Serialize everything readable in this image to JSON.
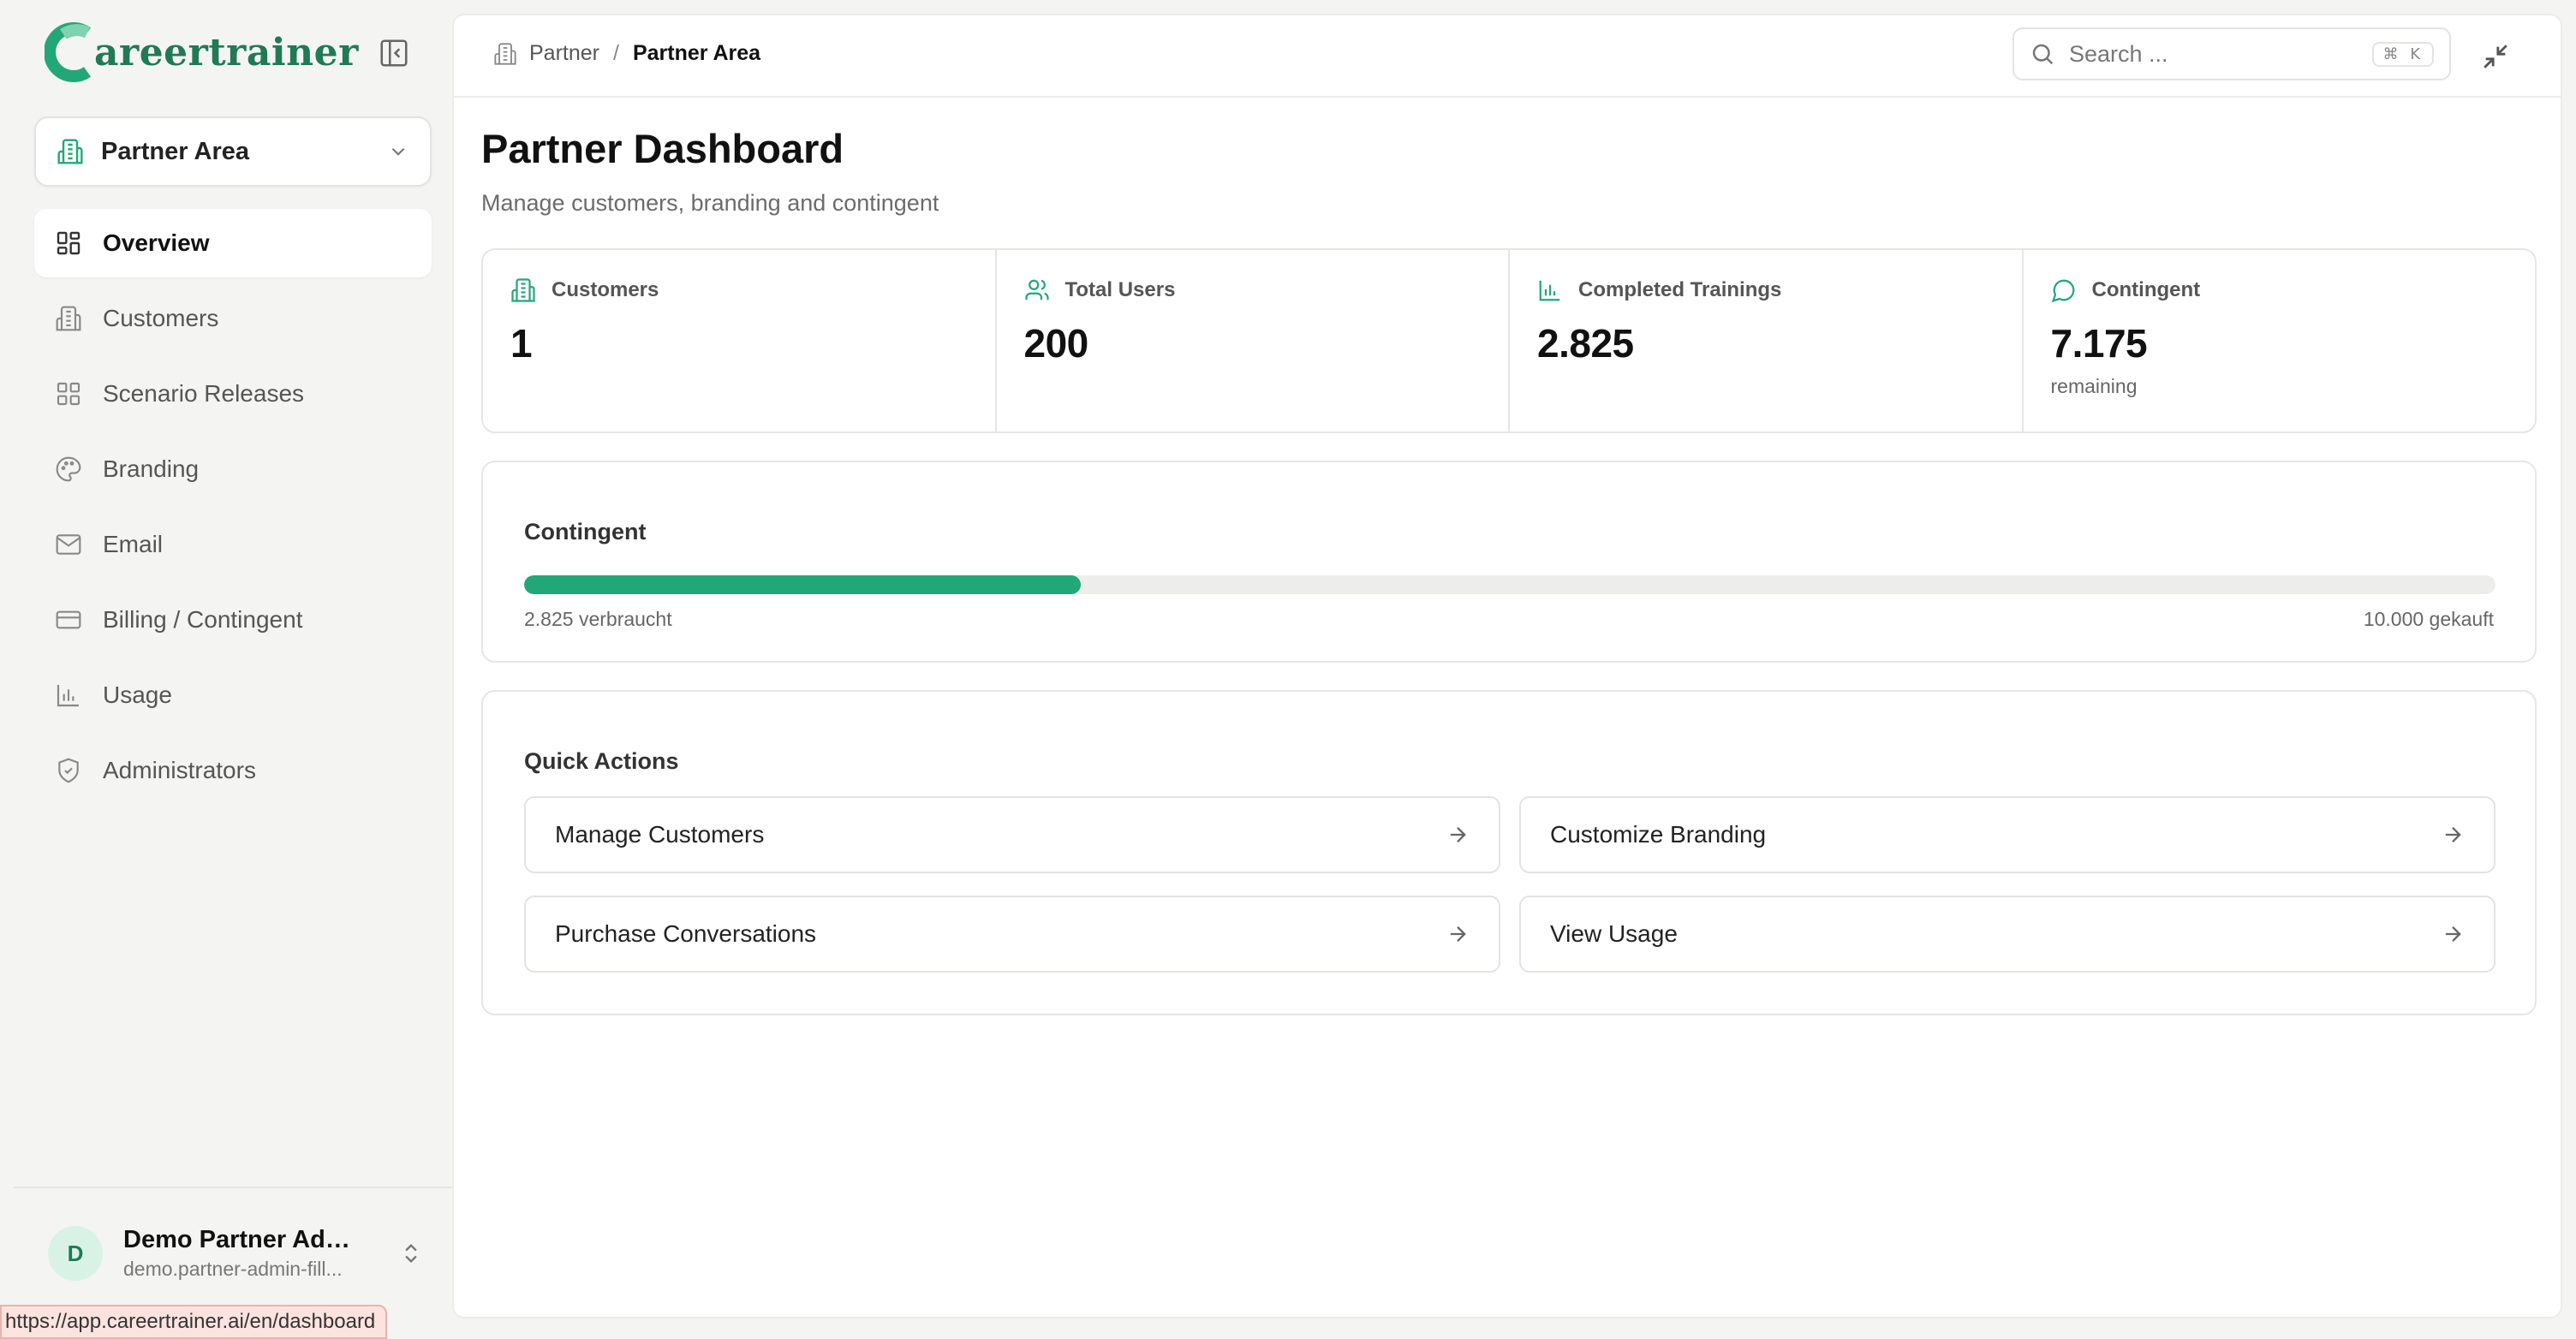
{
  "brand": {
    "name": "areertrainer",
    "color": "#1f7a55"
  },
  "sidebar": {
    "area_select": {
      "label": "Partner Area",
      "icon": "building-icon"
    },
    "items": [
      {
        "label": "Overview",
        "icon": "grid-icon",
        "active": true
      },
      {
        "label": "Customers",
        "icon": "building-icon"
      },
      {
        "label": "Scenario Releases",
        "icon": "grid-icon"
      },
      {
        "label": "Branding",
        "icon": "palette-icon"
      },
      {
        "label": "Email",
        "icon": "mail-icon"
      },
      {
        "label": "Billing / Contingent",
        "icon": "credit-card-icon"
      },
      {
        "label": "Usage",
        "icon": "bar-chart-icon"
      },
      {
        "label": "Administrators",
        "icon": "shield-icon"
      }
    ],
    "user": {
      "initial": "D",
      "name": "Demo Partner Admi...",
      "email": "demo.partner-admin-fill..."
    }
  },
  "status_bar": {
    "url": "https://app.careertrainer.ai/en/dashboard"
  },
  "header": {
    "breadcrumb": {
      "parent": "Partner",
      "separator": "/",
      "current": "Partner Area"
    },
    "search": {
      "placeholder": "Search ...",
      "shortcut": "⌘ K"
    }
  },
  "page": {
    "title": "Partner Dashboard",
    "subtitle": "Manage customers, branding and contingent"
  },
  "stats": [
    {
      "label": "Customers",
      "value": "1",
      "note": "",
      "icon": "building-icon"
    },
    {
      "label": "Total Users",
      "value": "200",
      "note": "",
      "icon": "users-icon"
    },
    {
      "label": "Completed Trainings",
      "value": "2.825",
      "note": "",
      "icon": "bar-chart-icon"
    },
    {
      "label": "Contingent",
      "value": "7.175",
      "note": "remaining",
      "icon": "message-circle-icon"
    }
  ],
  "contingent": {
    "title": "Contingent",
    "used_label": "2.825 verbraucht",
    "bought_label": "10.000 gekauft",
    "progress_fraction": 0.2825,
    "accent": "#22a878"
  },
  "quick_actions": {
    "title": "Quick Actions",
    "items": [
      {
        "label": "Manage Customers"
      },
      {
        "label": "Customize Branding"
      },
      {
        "label": "Purchase Conversations"
      },
      {
        "label": "View Usage"
      }
    ]
  }
}
